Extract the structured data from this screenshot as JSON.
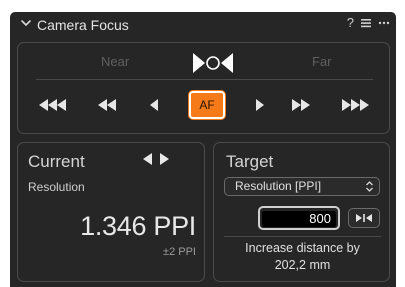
{
  "header": {
    "title": "Camera Focus",
    "help_label": "?",
    "menu_icon": "list-icon",
    "more_icon": "ellipsis-icon",
    "collapse_icon": "chevron-down-icon"
  },
  "focus_nav": {
    "near_label": "Near",
    "far_label": "Far",
    "af_label": "AF",
    "indicator_icon": "focus-indicator-icon",
    "buttons": [
      "step-near-large-icon",
      "step-near-medium-icon",
      "step-near-small-icon",
      "step-far-small-icon",
      "step-far-medium-icon",
      "step-far-large-icon"
    ]
  },
  "current": {
    "title": "Current",
    "metric_label": "Resolution",
    "value": "1.346 PPI",
    "tolerance": "±2 PPI"
  },
  "target": {
    "title": "Target",
    "select_value": "Resolution [PPI]",
    "input_value": "800",
    "message_line1": "Increase distance by",
    "message_line2": "202,2 mm"
  },
  "colors": {
    "panel_bg": "#262626",
    "accent": "#f57a1a",
    "border": "#4b4b4b"
  }
}
